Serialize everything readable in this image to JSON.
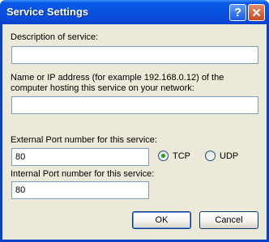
{
  "window": {
    "title": "Service Settings",
    "help_glyph": "?",
    "close_glyph": "✕"
  },
  "form": {
    "description_label": "Description of service:",
    "description_value": "",
    "host_label_line1": "Name or IP address (for example 192.168.0.12) of the",
    "host_label_line2": "computer hosting this service on your network:",
    "host_value": "",
    "external_port_label": "External Port number for this service:",
    "external_port_value": "80",
    "internal_port_label": "Internal Port number for this service:",
    "internal_port_value": "80",
    "protocol": {
      "tcp_label": "TCP",
      "udp_label": "UDP",
      "selected": "TCP"
    }
  },
  "buttons": {
    "ok_label": "OK",
    "cancel_label": "Cancel"
  }
}
